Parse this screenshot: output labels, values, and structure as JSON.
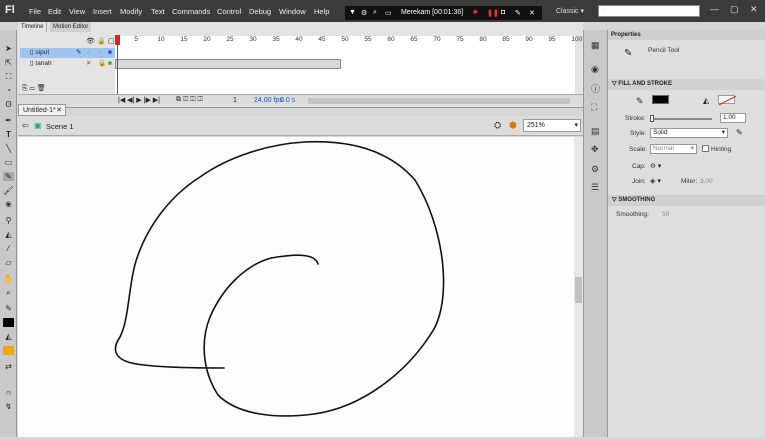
{
  "app": {
    "logo": "Fl"
  },
  "menus": [
    "File",
    "Edit",
    "View",
    "Insert",
    "Modify",
    "Text",
    "Commands",
    "Control",
    "Debug",
    "Window",
    "Help"
  ],
  "recorder": {
    "label": "Merekam [00:01:36]"
  },
  "workspace": {
    "name": "Classic"
  },
  "timeline": {
    "tabs": [
      "Timeline",
      "Motion Editor"
    ],
    "ruler": [
      "1",
      "5",
      "10",
      "15",
      "20",
      "25",
      "30",
      "35",
      "40",
      "45",
      "50",
      "55",
      "60",
      "65",
      "70",
      "75",
      "80",
      "85",
      "90",
      "95",
      "100"
    ],
    "layers": [
      {
        "name": "siput"
      },
      {
        "name": "tanah"
      }
    ],
    "footer": {
      "frame": "1",
      "fps": "24.00 fps",
      "time": "0.0 s"
    }
  },
  "document": {
    "tab": "Untitled-1*",
    "scene": "Scene 1",
    "zoom": "251%"
  },
  "properties": {
    "tab": "Properties",
    "tool": "Pencil Tool",
    "fill_stroke_header": "FILL AND STROKE",
    "stroke_label": "Stroke:",
    "stroke_value": "1.00",
    "style_label": "Style:",
    "style_value": "Solid",
    "scale_label": "Scale:",
    "scale_value": "Normal",
    "hinting_label": "Hinting",
    "cap_label": "Cap:",
    "join_label": "Join:",
    "miter_label": "Miter:",
    "miter_value": "3.00",
    "smoothing_header": "SMOOTHING",
    "smoothing_label": "Smoothing:",
    "smoothing_value": "50"
  },
  "colors": {
    "menubar": "#3b3b3b",
    "stage": "#fdfdfd",
    "selected_layer": "#9ec5f2",
    "playhead": "#e02020"
  }
}
